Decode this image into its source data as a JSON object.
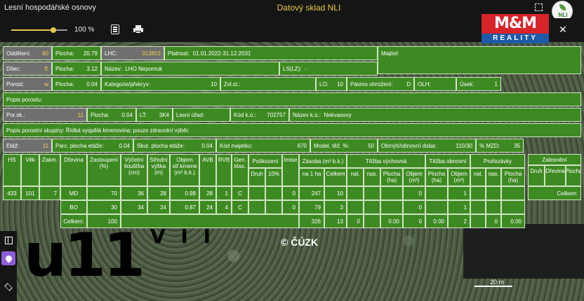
{
  "header": {
    "app_title": "Lesní hospodářské osnovy",
    "center_title": "Datový sklad NLI",
    "logo_text": "NLI"
  },
  "toolbar": {
    "zoom_value": 0.75,
    "zoom_label": "100 %"
  },
  "watermark": {
    "brand": "M&M",
    "sub": "REALITY"
  },
  "panel": {
    "r1": {
      "oddeleni_label": "Oddělení:",
      "oddeleni_value": "90",
      "plocha_label": "Plocha:",
      "plocha_value": "20.79",
      "lhc_label": "LHC:",
      "lhc_value": "313803",
      "platnost_label": "Platnost:",
      "platnost_value": "01.01.2022-31.12.2031",
      "majitel_label": "Majitel:"
    },
    "r2": {
      "dilec_label": "Dílec:",
      "dilec_value": "E",
      "plocha_label": "Plocha:",
      "plocha_value": "3.12",
      "nazev_label": "Název:",
      "nazev_value": "LHO Nepomuk",
      "ls_label": "LS(LZ):",
      "ls_value": "-"
    },
    "r3": {
      "porost_label": "Porost:",
      "porost_value": "w",
      "plocha_label": "Plocha:",
      "plocha_value": "0.04",
      "kategorie_label": "Kategorie/překryv:",
      "kategorie_value": "10",
      "zvl_label": "Zvl.st.:",
      "lo_label": "LO:",
      "lo_value": "10",
      "pasmo_label": "Pásmo ohrožení:",
      "pasmo_value": "D",
      "olh_label": "OLH:",
      "usek_label": "Úsek:",
      "usek_value": "1"
    },
    "r4": {
      "popis_porostu": "Popis porostu:"
    },
    "r5": {
      "porsk_label": "Por.sk.:",
      "porsk_value": "11",
      "plocha_label": "Plocha:",
      "plocha_value": "0.04",
      "lt_label": "LT:",
      "lt_value": "3K4",
      "lesni_urad": "Lesní úřad:",
      "kodku_label": "Kód k.ú.:",
      "kodku_value": "702757",
      "nazevku_label": "Název k.ú.:",
      "nazevku_value": "Nekvasovy"
    },
    "r6": {
      "popis_skupiny": "Popis porostní skupiny: Řídká vyspělá kmenovina; pouze zdravotní výběr."
    },
    "r7": {
      "etaz_label": "Etáž:",
      "etaz_value": "11",
      "parc_label": "Parc. plocha etáže:",
      "parc_value": "0.04",
      "skut_label": "Skut. plocha etáže:",
      "skut_value": "0.04",
      "kod_majetku_label": "Kód majetku:",
      "kod_majetku_value": "670",
      "model_label": "Model. těž. %:",
      "model_value": "50",
      "obmyti_label": "Obmýtí/obnovní doba:",
      "obmyti_value": "110/30",
      "mzd_label": "% MZD:",
      "mzd_value": "35"
    },
    "stand": {
      "headers": [
        "HS",
        "Věk",
        "Zakm."
      ],
      "values": [
        "433",
        "101",
        "7"
      ]
    },
    "species": {
      "h_dreviny": "Dřevina",
      "h_zastoupeni": "Zastoupení (%)",
      "h_vycetni": "Výčetní tloušťka (cm)",
      "h_stredni": "Střední výška (m)",
      "h_objem": "Objem stř.kmene (m³ b.k.)",
      "h_avb": "AVB",
      "h_rvb": "RVB",
      "h_gen": "Gen. klas.",
      "h_poskozeni": "Poškození",
      "h_druh": "Druh",
      "h_10": "10%",
      "h_imise": "Imise",
      "h_zasoba": "Zásoba (m³ b.k.)",
      "h_na1ha": "na 1 ha",
      "h_celkem": "Celkem",
      "h_tezba_vych": "Těžba výchovná",
      "h_tezba_obn": "Těžba obnovní",
      "h_prorezavky": "Prořezávky",
      "h_nal": "nal.",
      "h_nas": "nas.",
      "h_plocha_ha": "Plocha (ha)",
      "h_objem_m3": "Objem (m³)",
      "rows": [
        {
          "drevina": "MD",
          "zast": "70",
          "vyc": "36",
          "str": "28",
          "obj": "0.98",
          "avb": "28",
          "rvb": "1",
          "gen": "C",
          "imise": "0",
          "na1ha": "247",
          "celkem": "10",
          "tv_obj": "0",
          "to_obj": "1"
        },
        {
          "drevina": "BO",
          "zast": "30",
          "vyc": "34",
          "str": "24",
          "obj": "0.87",
          "avb": "24",
          "rvb": "4",
          "gen": "C",
          "imise": "0",
          "na1ha": "79",
          "celkem": "3",
          "tv_obj": "0",
          "to_obj": "1"
        }
      ],
      "total": {
        "label": "Celkem:",
        "zast": "100",
        "na1ha": "326",
        "celkem": "13",
        "tv_nal": "0",
        "tv_plocha": "0.00",
        "tv_obj": "0",
        "to_plocha": "0.00",
        "to_obj": "2",
        "pr_nas": "0",
        "pr_plocha": "0.00"
      }
    },
    "zalesneni": {
      "title": "Zalesnění",
      "h_druh": "Druh",
      "h_drevina": "Dřevina",
      "h_plocha": "Plocha",
      "total_label": "Celkem:"
    }
  },
  "map": {
    "label_big": "u11",
    "label_small": "V I I",
    "copyright": "© ČÚZK",
    "scale_label": "20 m"
  },
  "colors": {
    "panel_green": "#3e8a22",
    "panel_gray": "#6f6f6f",
    "accent_yellow": "#f0cf4a",
    "title_yellow": "#e6c94a",
    "border": "#cfe6c2"
  }
}
